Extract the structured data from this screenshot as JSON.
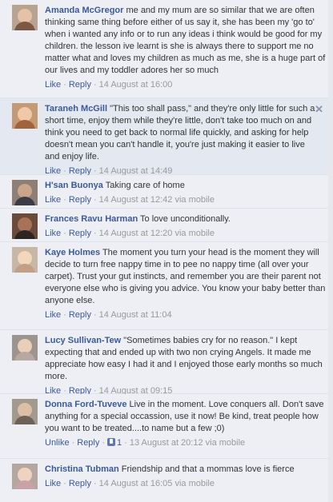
{
  "comments": [
    {
      "author": "Amanda McGregor",
      "text": " me and my mum are so similar that we are often thinking same thing before either of us say it, she has been my 'go to' when i wanted any info or to run any ideas i think would be good for my children. the lesson ive learnt is she is always there to support me no matter what and loves my children as much as me, she is a huge part of our lives and my toddler adores her so much",
      "like": "Like",
      "reply": "Reply",
      "date": "14 August at 16:00",
      "via": ""
    },
    {
      "author": "Taraneh McGill",
      "text": " \"This too shall pass,\" and they're only little for such a short time, enjoy them while they're little, don't take too much on and think you need to get back to normal life quickly, and asking for help doesn't mean you can't handle it, you're just making it easier to live and enjoy life.",
      "like": "Like",
      "reply": "Reply",
      "date": "14 August at 14:49",
      "via": ""
    },
    {
      "author": "H'san Buonya",
      "text": " Taking care of home",
      "like": "Like",
      "reply": "Reply",
      "date": "14 August at 12:42",
      "via": "via mobile"
    },
    {
      "author": "Frances Ravu Harman",
      "text": " To love unconditionally.",
      "like": "Like",
      "reply": "Reply",
      "date": "14 August at 12:20",
      "via": "via mobile"
    },
    {
      "author": "Kaye Holmes",
      "text": " The moment you turn your head is the moment they will decide to turn free nappy time in to pee no nappy time (all over your carpet). Trust your gut instincts, and remember you are their parent not everyone else who is giving you advice. You know your baby better than anyone else.",
      "like": "Like",
      "reply": "Reply",
      "date": "14 August at 11:04",
      "via": ""
    },
    {
      "author": "Lucy Sullivan-Tew",
      "text": " \"Sometimes babies cry for no reason.\" I kept expecting that and ended up with two non crying Angels. It made me appreciate how easy I had it and I enjoyed those early months so much more.",
      "like": "Like",
      "reply": "Reply",
      "date": "14 August at 09:15",
      "via": ""
    },
    {
      "author": "Donna Ford-Tuveve",
      "text": " Live in the moment. Love conquers all. Don't save anything for a special occassion, use it now! Be kind, treat people how you want to be treated....to name but a few ;0)",
      "like": "Unlike",
      "reply": "Reply",
      "likes_count": "1",
      "date": "13 August at 20:12",
      "via": "via mobile"
    },
    {
      "author": "Christina Tubman",
      "text": " Friendship and that a mommas love is fierce",
      "like": "Like",
      "reply": "Reply",
      "date": "14 August at 16:05",
      "via": "via mobile"
    }
  ],
  "close_glyph": "✕",
  "separator": "·",
  "colors": {
    "link": "#3b5998",
    "background": "#edeff4",
    "muted": "#999999"
  }
}
